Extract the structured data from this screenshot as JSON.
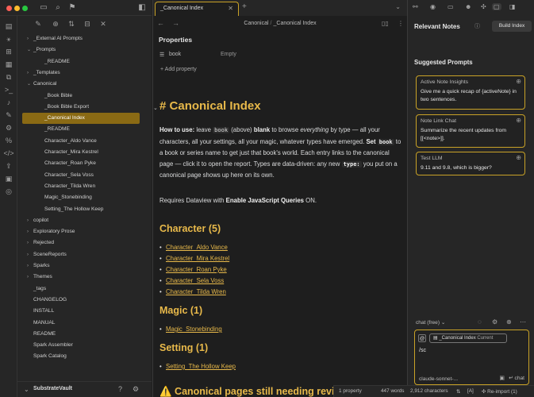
{
  "sidebar": {
    "tree": [
      {
        "label": "_External AI Prompts",
        "type": "folder",
        "expanded": false,
        "depth": 0
      },
      {
        "label": "_Prompts",
        "type": "folder",
        "expanded": true,
        "depth": 0
      },
      {
        "label": "_README",
        "type": "file",
        "depth": 1
      },
      {
        "label": "_Templates",
        "type": "folder",
        "expanded": false,
        "depth": 0
      },
      {
        "label": "Canonical",
        "type": "folder",
        "expanded": true,
        "depth": 0
      },
      {
        "label": "_Book Bible",
        "type": "file",
        "depth": 1
      },
      {
        "label": "_Book Bible Export",
        "type": "file",
        "depth": 1
      },
      {
        "label": "_Canonical Index",
        "type": "file",
        "depth": 1,
        "active": true
      },
      {
        "label": "_README",
        "type": "file",
        "depth": 1
      },
      {
        "label": "Character_Aldo Vance",
        "type": "file",
        "depth": 1
      },
      {
        "label": "Character_Mira Kestrel",
        "type": "file",
        "depth": 1
      },
      {
        "label": "Character_Roan Pyke",
        "type": "file",
        "depth": 1
      },
      {
        "label": "Character_Sela Voss",
        "type": "file",
        "depth": 1
      },
      {
        "label": "Character_Tilda Wren",
        "type": "file",
        "depth": 1
      },
      {
        "label": "Magic_Stonebinding",
        "type": "file",
        "depth": 1
      },
      {
        "label": "Setting_The Hollow Keep",
        "type": "file",
        "depth": 1
      },
      {
        "label": "copilot",
        "type": "folder",
        "expanded": false,
        "depth": 0
      },
      {
        "label": "Exploratory Prose",
        "type": "folder",
        "expanded": false,
        "depth": 0
      },
      {
        "label": "Rejected",
        "type": "folder",
        "expanded": false,
        "depth": 0
      },
      {
        "label": "SceneReports",
        "type": "folder",
        "expanded": false,
        "depth": 0
      },
      {
        "label": "Sparks",
        "type": "folder",
        "expanded": false,
        "depth": 0
      },
      {
        "label": "Themes",
        "type": "folder",
        "expanded": false,
        "depth": 0
      },
      {
        "label": "_tags",
        "type": "file",
        "depth": 0
      },
      {
        "label": "CHANGELOG",
        "type": "file",
        "depth": 0
      },
      {
        "label": "INSTALL",
        "type": "file",
        "depth": 0
      },
      {
        "label": "MANUAL",
        "type": "file",
        "depth": 0
      },
      {
        "label": "README",
        "type": "file",
        "depth": 0
      },
      {
        "label": "Spark Assembler",
        "type": "file",
        "depth": 0
      },
      {
        "label": "Spark Catalog",
        "type": "file",
        "depth": 0
      }
    ],
    "vault_name": "SubstrateVault"
  },
  "tab": {
    "title": "_Canonical Index"
  },
  "view_header": {
    "breadcrumb_parent": "Canonical",
    "breadcrumb_sep": "/",
    "breadcrumb_current": "_Canonical Index"
  },
  "properties": {
    "heading": "Properties",
    "rows": [
      {
        "key": "book",
        "value": "Empty"
      }
    ],
    "add_label": "Add property"
  },
  "doc": {
    "h1_hash": "#",
    "h1": "Canonical Index",
    "p1": {
      "a": "How to use:",
      "b": " leave ",
      "c": "book",
      "d": " (above) ",
      "e": "blank",
      "f": " to browse ",
      "g": "everything",
      "h": " by type — all your characters, all your settings, all your magic, whatever types have emerged. ",
      "i": "Set ",
      "j": "book",
      "k": " to a book or series name to get just that book's world. Each entry links to the canonical page — click it to open the report. Types are data-driven: any new ",
      "l": "type:",
      "m": " you put on a canonical page shows up here on its own."
    },
    "p2": {
      "a": "Requires Dataview with ",
      "b": "Enable JavaScript Queries",
      "c": " ON."
    },
    "sections": [
      {
        "heading": "Character (5)",
        "links": [
          "Character_Aldo Vance",
          "Character_Mira Kestrel",
          "Character_Roan Pyke",
          "Character_Sela Voss",
          "Character_Tilda Wren"
        ]
      },
      {
        "heading": "Magic (1)",
        "links": [
          "Magic_Stonebinding"
        ]
      },
      {
        "heading": "Setting (1)",
        "links": [
          "Setting_The Hollow Keep"
        ]
      }
    ],
    "warn_heading": "⚠️ Canonical pages still needing review"
  },
  "status": {
    "properties": "1 property",
    "words": "447 words",
    "chars": "2,912 characters",
    "mode": "[A]",
    "reimport": "Re-import (1)"
  },
  "right_panel": {
    "relevant_title": "Relevant Notes",
    "build_index": "Build Index",
    "suggested_title": "Suggested Prompts",
    "prompts": [
      {
        "title": "Active Note Insights",
        "body": "Give me a quick recap of {activeNote} in two sentences."
      },
      {
        "title": "Note Link Chat",
        "body": "Summarize the recent updates from [[<note>]]."
      },
      {
        "title": "Test LLM",
        "body": "9.11 and 9.8, which is bigger?"
      }
    ],
    "chat_mode": "chat (free)",
    "chip_note": "_Canonical Index",
    "chip_current": "Current",
    "chat_input": "/sc",
    "model": "claude-sonnet-...",
    "send": "chat"
  },
  "colors": {
    "accent": "#c9a227",
    "heading": "#e8b94a",
    "active_item": "#8a6a14"
  }
}
